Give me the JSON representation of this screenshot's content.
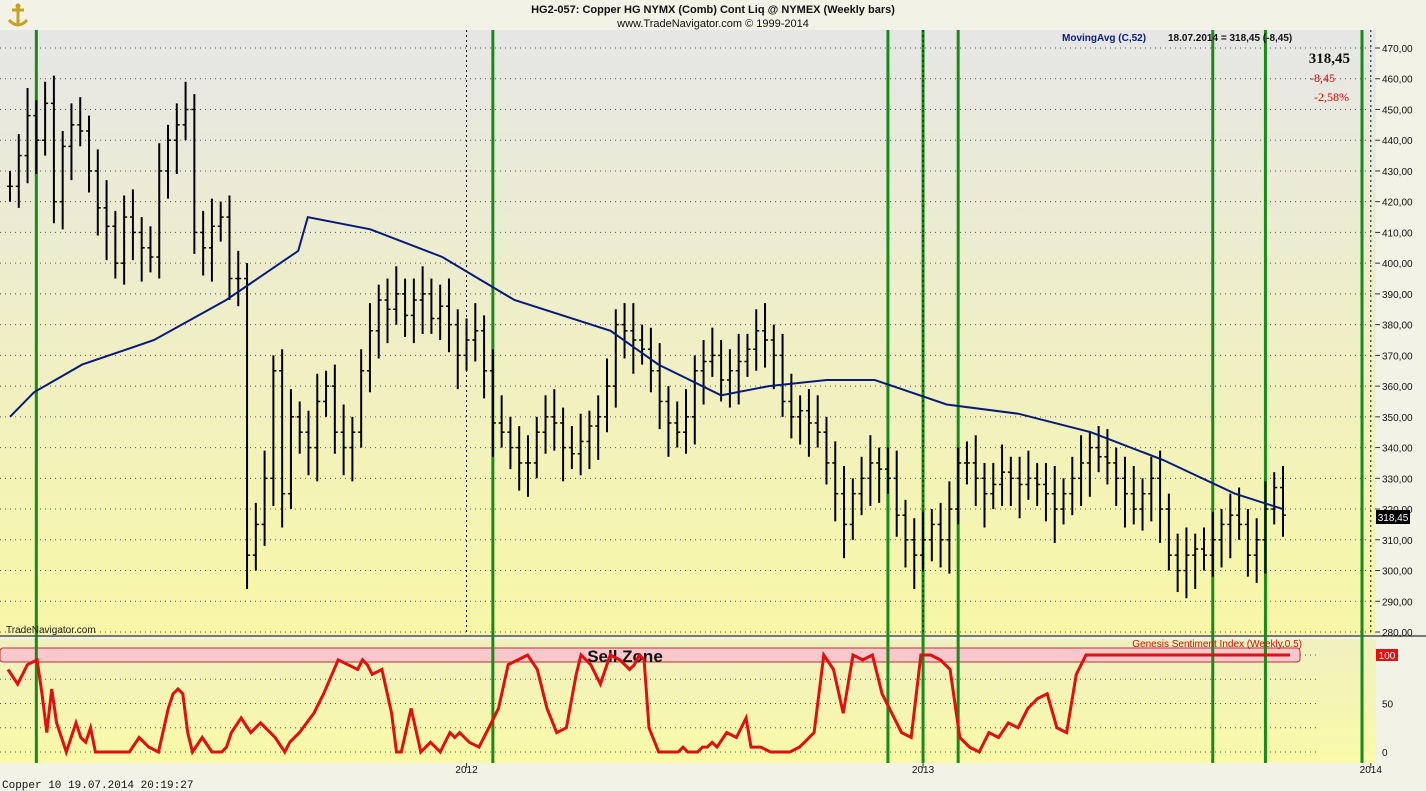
{
  "header": {
    "title": "HG2-057:  Copper HG NYMX (Comb) Cont Liq @ NYMEX  (Weekly bars)",
    "subtitle": "www.TradeNavigator.com © 1999-2014",
    "watermark": "TradeNavigator.com",
    "status_line": "Copper 10   19.07.2014 20:19:27"
  },
  "quote": {
    "last": "318,45",
    "change": "-8,45",
    "change_pct": "-2,58%",
    "last_badge": "318,45"
  },
  "colors": {
    "price_bars": "#000000",
    "moving_avg": "#0a1a7a",
    "sentiment": "#e01010",
    "signal_lines": "#1a8a1a",
    "sell_zone_fill": "#f8c8cc",
    "negative": "#dd0000"
  },
  "chart_data": [
    {
      "type": "ohlc",
      "name": "price",
      "ylim": [
        280,
        470
      ],
      "y_ticks": [
        "470,00",
        "460,00",
        "450,00",
        "440,00",
        "430,00",
        "420,00",
        "410,00",
        "400,00",
        "390,00",
        "380,00",
        "370,00",
        "360,00",
        "350,00",
        "340,00",
        "330,00",
        "320,00",
        "310,00",
        "300,00",
        "290,00",
        "280,00"
      ],
      "x_ticks": [
        "2012",
        "2013",
        "2014"
      ],
      "grid": true,
      "series": [
        {
          "name": "MovingAvg (C,52)",
          "legend": "MovingAvg (C,52)",
          "legend_value": "18.07.2014 = 318,45 (-8,45)",
          "x": [
            0,
            5,
            15,
            30,
            45,
            60,
            62,
            75,
            90,
            105,
            125,
            135,
            148,
            158,
            170,
            180,
            195,
            210,
            225,
            240,
            255,
            265
          ],
          "y": [
            350,
            358,
            367,
            375,
            388,
            404,
            415,
            411,
            402,
            388,
            378,
            367,
            357,
            360,
            362,
            362,
            354,
            351,
            345,
            336,
            325,
            320
          ]
        }
      ],
      "bars_weekly_closes": [
        425,
        435,
        448,
        440,
        452,
        420,
        438,
        445,
        443,
        430,
        418,
        412,
        400,
        415,
        410,
        405,
        402,
        430,
        440,
        445,
        450,
        410,
        405,
        412,
        415,
        395,
        395,
        305,
        315,
        330,
        365,
        325,
        350,
        345,
        340,
        355,
        360,
        345,
        340,
        345,
        365,
        378,
        388,
        385,
        390,
        383,
        388,
        390,
        382,
        386,
        380,
        370,
        375,
        378,
        365,
        348,
        345,
        340,
        335,
        335,
        345,
        350,
        348,
        340,
        338,
        342,
        347,
        350,
        360,
        380,
        378,
        375,
        372,
        365,
        355,
        348,
        345,
        350,
        365,
        368,
        370,
        362,
        365,
        368,
        372,
        378,
        375,
        370,
        355,
        350,
        352,
        348,
        345,
        335,
        325,
        315,
        325,
        330,
        335,
        333,
        330,
        318,
        310,
        305,
        310,
        315,
        310,
        320,
        335,
        335,
        330,
        325,
        328,
        332,
        330,
        328,
        330,
        328,
        325,
        320,
        325,
        330,
        335,
        340,
        337,
        335,
        330,
        325,
        320,
        325,
        330,
        320,
        305,
        300,
        305,
        307,
        305,
        310,
        315,
        318,
        315,
        305,
        310,
        320,
        327,
        318
      ],
      "last_value": 318.45
    },
    {
      "type": "line",
      "name": "sentiment",
      "title": "Genesis Sentiment Index (Weekly,0.5)",
      "zone_label": "Sell Zone",
      "ylim": [
        0,
        100
      ],
      "y_ticks": [
        "100",
        "50",
        "0"
      ],
      "series": [
        {
          "name": "Genesis Sentiment Index (Weekly,0.5)",
          "x": [
            0,
            2,
            4,
            6,
            7,
            8,
            9,
            10,
            12,
            14,
            15,
            16,
            17,
            18,
            20,
            25,
            27,
            29,
            31,
            33,
            34,
            35,
            36,
            37,
            38,
            40,
            42,
            44,
            45,
            46,
            48,
            50,
            52,
            55,
            57,
            58,
            60,
            63,
            65,
            68,
            70,
            72,
            73,
            74,
            75,
            77,
            79,
            80,
            81,
            83,
            85,
            87,
            89,
            91,
            92,
            93,
            95,
            97,
            99,
            101,
            103,
            105,
            107,
            109,
            111,
            113,
            115,
            117,
            118,
            120,
            122,
            124,
            126,
            128,
            129,
            130,
            131,
            132,
            134,
            136,
            138,
            139,
            140,
            141,
            142,
            143,
            144,
            145,
            146,
            148,
            150,
            152,
            153,
            155,
            157,
            159,
            161,
            163,
            164,
            166,
            168,
            170,
            172,
            174,
            176,
            178,
            180,
            182,
            184,
            186,
            188,
            190,
            192,
            194,
            196,
            198,
            200,
            202,
            204,
            206,
            208,
            210,
            212,
            214,
            216,
            218,
            220,
            222,
            224,
            226,
            228,
            230,
            232,
            234,
            236,
            238,
            240,
            242,
            244,
            246,
            248,
            250,
            252,
            254,
            256,
            258,
            260,
            262,
            264
          ],
          "y": [
            85,
            70,
            90,
            95,
            60,
            20,
            65,
            30,
            0,
            30,
            15,
            10,
            25,
            0,
            0,
            0,
            15,
            5,
            0,
            45,
            60,
            65,
            60,
            20,
            0,
            15,
            0,
            0,
            5,
            20,
            35,
            20,
            30,
            15,
            0,
            10,
            20,
            40,
            60,
            95,
            90,
            85,
            95,
            90,
            80,
            85,
            40,
            0,
            0,
            45,
            0,
            10,
            0,
            20,
            15,
            20,
            10,
            5,
            25,
            45,
            90,
            95,
            100,
            85,
            45,
            20,
            25,
            80,
            100,
            90,
            70,
            100,
            95,
            85,
            90,
            100,
            95,
            25,
            0,
            0,
            0,
            5,
            0,
            0,
            0,
            5,
            5,
            10,
            5,
            20,
            15,
            35,
            5,
            5,
            0,
            0,
            0,
            5,
            10,
            20,
            100,
            85,
            40,
            100,
            95,
            100,
            60,
            40,
            20,
            15,
            100,
            100,
            95,
            85,
            15,
            5,
            0,
            20,
            15,
            30,
            25,
            45,
            55,
            60,
            25,
            20,
            80,
            100,
            100,
            100,
            100,
            100,
            100,
            100,
            100,
            100,
            100,
            100,
            100,
            100,
            100,
            100,
            100,
            100,
            100,
            100,
            100,
            100,
            100
          ]
        }
      ]
    }
  ]
}
